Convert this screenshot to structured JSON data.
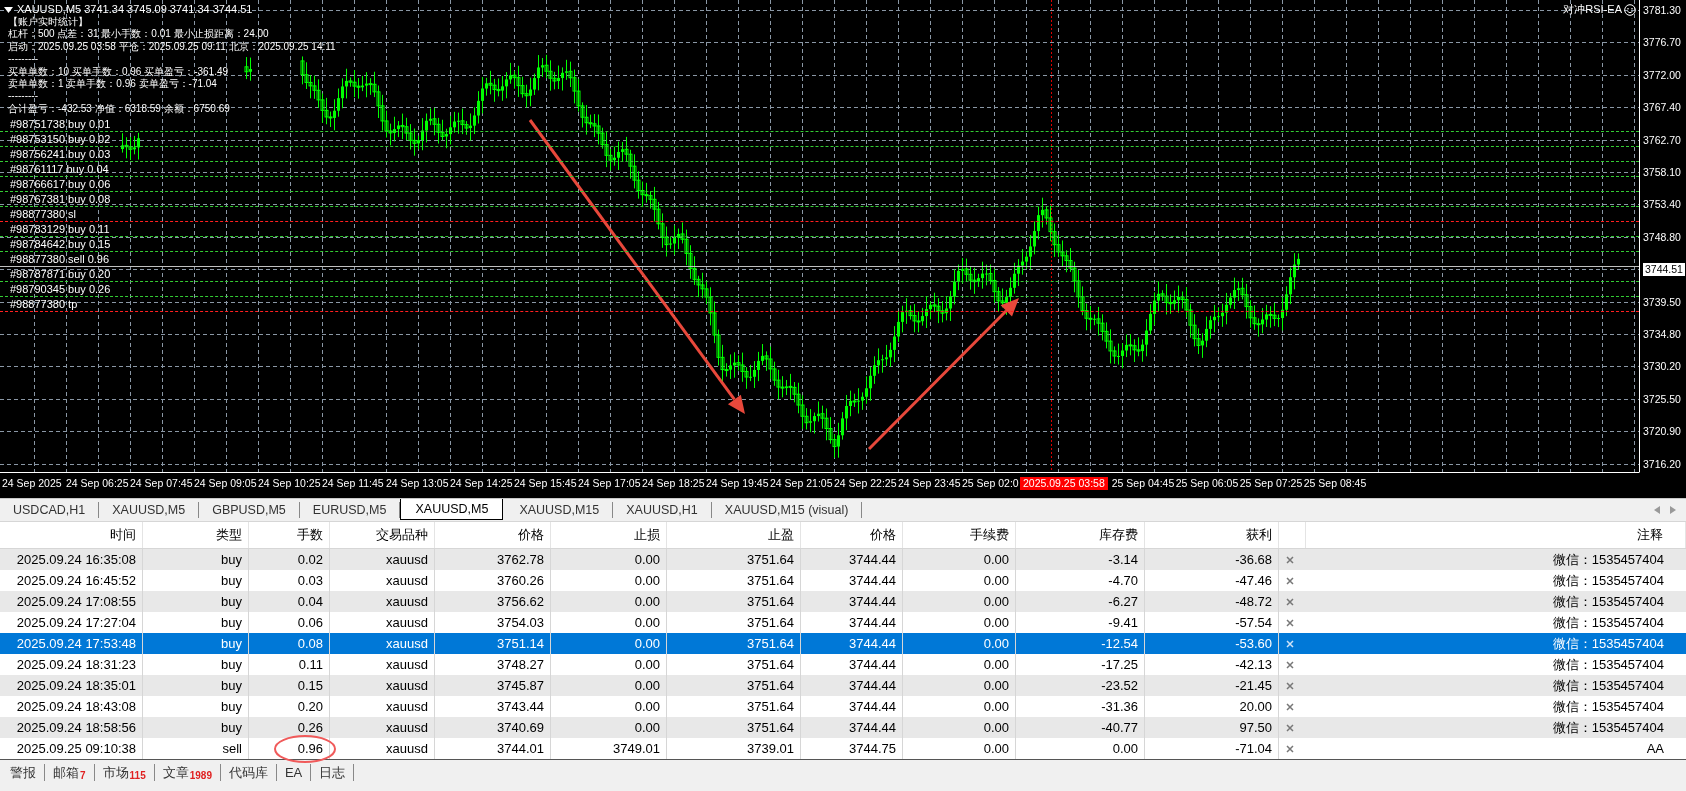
{
  "chart": {
    "title": "XAUUSD,M5 3741.34 3745.09 3741.34 3744.51",
    "ea_name": "对冲RSI-EA",
    "info_lines": [
      "【账户实时统计】",
      "杠杆：500  点差：31  最小手数：0.01  最小止损距离：24.00",
      "启动：2025.09.25 03:58  平仓：2025.09.25 09:11  北京：2025.09.25 14:11",
      "---------",
      "买单单数：10  买单手数：0.96  买单盈亏：-361.49",
      "卖单单数：1  卖单手数：0.96  卖单盈亏：-71.04",
      "---------",
      "合计盈亏：-432.53  净值：6318.59  余额：6750.69"
    ],
    "order_lines": [
      {
        "label": "#98751738 buy 0.01",
        "kind": "buy"
      },
      {
        "label": "#98753150 buy 0.02",
        "kind": "buy"
      },
      {
        "label": "#98756241 buy 0.03",
        "kind": "buy"
      },
      {
        "label": "#98761117 buy 0.04",
        "kind": "buy"
      },
      {
        "label": "#98766617 buy 0.06",
        "kind": "buy"
      },
      {
        "label": "#98767381 buy 0.08",
        "kind": "buy"
      },
      {
        "label": "#98877380 sl",
        "kind": "stop"
      },
      {
        "label": "#98783129 buy 0.11",
        "kind": "buy"
      },
      {
        "label": "#98784642 buy 0.15",
        "kind": "buy"
      },
      {
        "label": "#98877380 sell 0.96",
        "kind": "sell"
      },
      {
        "label": "#98787871 buy 0.20",
        "kind": "buy"
      },
      {
        "label": "#98790345 buy 0.26",
        "kind": "buy"
      },
      {
        "label": "#98877380 tp",
        "kind": "stop"
      }
    ],
    "price_axis": [
      "3781.30",
      "3776.70",
      "3772.00",
      "3767.40",
      "3762.70",
      "3758.10",
      "3753.40",
      "3748.80",
      "3744.51",
      "3739.50",
      "3734.80",
      "3730.20",
      "3725.50",
      "3720.90",
      "3716.20"
    ],
    "time_axis": [
      "24 Sep 2025",
      "24 Sep 06:25",
      "24 Sep 07:45",
      "24 Sep 09:05",
      "24 Sep 10:25",
      "24 Sep 11:45",
      "24 Sep 13:05",
      "24 Sep 14:25",
      "24 Sep 15:45",
      "24 Sep 17:05",
      "24 Sep 18:25",
      "24 Sep 19:45",
      "24 Sep 21:05",
      "24 Sep 22:25",
      "24 Sep 23:45",
      "25 Sep 02:0",
      "25 Sep 04:45",
      "25 Sep 06:05",
      "25 Sep 07:25",
      "25 Sep 08:45"
    ],
    "cursor_time": "2025.09.25 03:58"
  },
  "chart_tabs": [
    {
      "label": "USDCAD,H1",
      "selected": false
    },
    {
      "label": "XAUUSD,M5",
      "selected": false
    },
    {
      "label": "GBPUSD,M5",
      "selected": false
    },
    {
      "label": "EURUSD,M5",
      "selected": false
    },
    {
      "label": "XAUUSD,M5",
      "selected": true
    },
    {
      "label": "XAUUSD,M15",
      "selected": false
    },
    {
      "label": "XAUUSD,H1",
      "selected": false
    },
    {
      "label": "XAUUSD,M15 (visual)",
      "selected": false
    }
  ],
  "table": {
    "columns": [
      "时间",
      "类型",
      "手数",
      "交易品种",
      "价格",
      "止损",
      "止盈",
      "价格",
      "手续费",
      "库存费",
      "获利",
      "注释"
    ],
    "rows": [
      {
        "cells": [
          "2025.09.24 16:35:08",
          "buy",
          "0.02",
          "xauusd",
          "3762.78",
          "0.00",
          "3751.64",
          "3744.44",
          "0.00",
          "-3.14",
          "-36.68",
          "微信：1535457404"
        ],
        "selected": false,
        "circled": false
      },
      {
        "cells": [
          "2025.09.24 16:45:52",
          "buy",
          "0.03",
          "xauusd",
          "3760.26",
          "0.00",
          "3751.64",
          "3744.44",
          "0.00",
          "-4.70",
          "-47.46",
          "微信：1535457404"
        ],
        "selected": false,
        "circled": false
      },
      {
        "cells": [
          "2025.09.24 17:08:55",
          "buy",
          "0.04",
          "xauusd",
          "3756.62",
          "0.00",
          "3751.64",
          "3744.44",
          "0.00",
          "-6.27",
          "-48.72",
          "微信：1535457404"
        ],
        "selected": false,
        "circled": false
      },
      {
        "cells": [
          "2025.09.24 17:27:04",
          "buy",
          "0.06",
          "xauusd",
          "3754.03",
          "0.00",
          "3751.64",
          "3744.44",
          "0.00",
          "-9.41",
          "-57.54",
          "微信：1535457404"
        ],
        "selected": false,
        "circled": false
      },
      {
        "cells": [
          "2025.09.24 17:53:48",
          "buy",
          "0.08",
          "xauusd",
          "3751.14",
          "0.00",
          "3751.64",
          "3744.44",
          "0.00",
          "-12.54",
          "-53.60",
          "微信：1535457404"
        ],
        "selected": true,
        "circled": false
      },
      {
        "cells": [
          "2025.09.24 18:31:23",
          "buy",
          "0.11",
          "xauusd",
          "3748.27",
          "0.00",
          "3751.64",
          "3744.44",
          "0.00",
          "-17.25",
          "-42.13",
          "微信：1535457404"
        ],
        "selected": false,
        "circled": false
      },
      {
        "cells": [
          "2025.09.24 18:35:01",
          "buy",
          "0.15",
          "xauusd",
          "3745.87",
          "0.00",
          "3751.64",
          "3744.44",
          "0.00",
          "-23.52",
          "-21.45",
          "微信：1535457404"
        ],
        "selected": false,
        "circled": false
      },
      {
        "cells": [
          "2025.09.24 18:43:08",
          "buy",
          "0.20",
          "xauusd",
          "3743.44",
          "0.00",
          "3751.64",
          "3744.44",
          "0.00",
          "-31.36",
          "20.00",
          "微信：1535457404"
        ],
        "selected": false,
        "circled": false
      },
      {
        "cells": [
          "2025.09.24 18:58:56",
          "buy",
          "0.26",
          "xauusd",
          "3740.69",
          "0.00",
          "3751.64",
          "3744.44",
          "0.00",
          "-40.77",
          "97.50",
          "微信：1535457404"
        ],
        "selected": false,
        "circled": false
      },
      {
        "cells": [
          "2025.09.25 09:10:38",
          "sell",
          "0.96",
          "xauusd",
          "3744.01",
          "3749.01",
          "3739.01",
          "3744.75",
          "0.00",
          "0.00",
          "-71.04",
          "AA"
        ],
        "selected": false,
        "circled": true
      }
    ]
  },
  "bottom_tabs": [
    {
      "label": "警报"
    },
    {
      "label": "邮箱",
      "badge": "7"
    },
    {
      "label": "市场",
      "badge": "115"
    },
    {
      "label": "文章",
      "badge": "1989"
    },
    {
      "label": "代码库"
    },
    {
      "label": "EA"
    },
    {
      "label": "日志"
    }
  ]
}
